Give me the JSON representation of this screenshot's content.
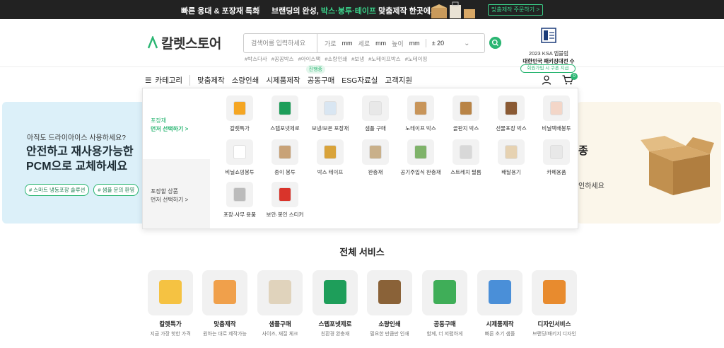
{
  "topbar": {
    "left_text": "빠른 응대 & 포장재 특화",
    "mid_prefix": "브랜딩의 완성, ",
    "mid_highlight": "박스·봉투·테이프",
    "mid_suffix": " 맞춤제작 한곳에서!",
    "cta": "맞춤제작 주문하기 >"
  },
  "header": {
    "logo_text": "칼렛스토어",
    "search_placeholder": "검색어를 입력하세요",
    "dims": {
      "w_label": "가로",
      "w_unit": "mm",
      "d_label": "세로",
      "d_unit": "mm",
      "h_label": "높이",
      "h_unit": "mm",
      "tolerance": "± 20"
    },
    "tags": [
      "#박스다사",
      "#꽁꽁박스",
      "#아이스팩",
      "#소량인쇄",
      "#보냉",
      "#노테이프박스",
      "#노테이핑"
    ],
    "award_line1": "2023 KSA 엠블럼",
    "award_line2": "대한민국 패키징대전 수상"
  },
  "nav": {
    "category": "카테고리",
    "items": [
      "맞춤제작",
      "소량인쇄",
      "시제품제작",
      "공동구매",
      "ESG자료실",
      "고객지원"
    ],
    "badge": "진행중",
    "signup": "회원가입 시 쿠폰 지급",
    "cart_count": "0"
  },
  "hero_left": {
    "question": "아직도 드라이아이스 사용하세요?",
    "headline1": "안전하고 재사용가능한",
    "headline2": "PCM으로 교체하세요",
    "chip1": "# 스마트 냉동포장 솔루션",
    "chip2": "# 샘플 문의 환영"
  },
  "hero_right": {
    "line1": "종",
    "line2": "인하세요"
  },
  "mega": {
    "side1_l1": "포장재",
    "side1_l2": "먼저 선택하기 >",
    "side2_l1": "포장할 상품",
    "side2_l2": "먼저 선택하기 >",
    "items": [
      "칼렛특가",
      "스텝포넷제로",
      "보냉/보온 포장재",
      "샘플 구매",
      "노테이프 박스",
      "골판지 박스",
      "선물포장 박스",
      "비닐택배봉투",
      "비닐쇼핑봉투",
      "종이 봉투",
      "박스 테이프",
      "완충재",
      "공기주입식 완충재",
      "스트레치 필름",
      "배달용기",
      "카페용품",
      "포장·사무 용품",
      "보안·봉인 스티커"
    ]
  },
  "services": {
    "title": "전체 서비스",
    "items": [
      {
        "name": "칼렛특가",
        "desc": "지금 가장 핫한 가격"
      },
      {
        "name": "맞춤제작",
        "desc": "원하는 대로 제작가능"
      },
      {
        "name": "샘플구매",
        "desc": "사이즈, 재질 체크"
      },
      {
        "name": "스텝포넷제로",
        "desc": "친환경 완충재"
      },
      {
        "name": "소량인쇄",
        "desc": "필요한 만큼만 인쇄"
      },
      {
        "name": "공동구매",
        "desc": "함께, 더 저렴하게"
      },
      {
        "name": "시제품제작",
        "desc": "빠른 초기 샘플"
      },
      {
        "name": "디자인서비스",
        "desc": "브랜딩/패키지 디자인"
      }
    ]
  },
  "colors": {
    "brand": "#2bb673",
    "topbar": "#222222",
    "hero_left_bg": "#dcf0f9",
    "hero_right_bg": "#fbf6ea"
  }
}
